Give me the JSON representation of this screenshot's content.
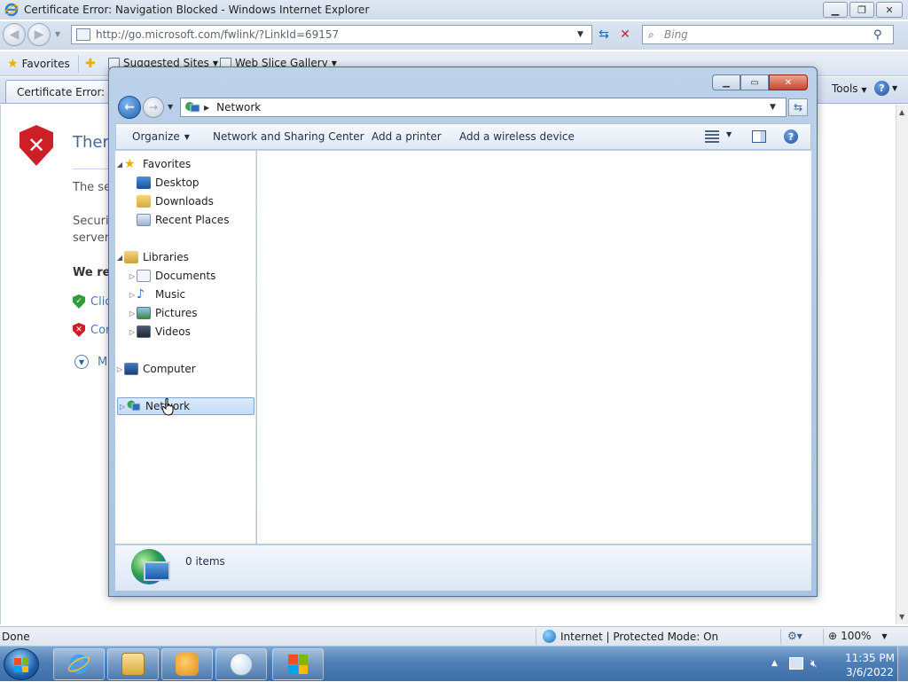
{
  "ie": {
    "title": "Certificate Error: Navigation Blocked - Windows Internet Explorer",
    "url": "http://go.microsoft.com/fwlink/?LinkId=69157",
    "search_placeholder": "Bing",
    "favorites_label": "Favorites",
    "suggested_sites": "Suggested Sites",
    "web_slice_gallery": "Web Slice Gallery",
    "tab_label": "Certificate Error: N",
    "tools_label": "Tools",
    "content": {
      "title": "There",
      "p1": "The se",
      "p2a": "Securit",
      "p2b": "server.",
      "bold": "We re",
      "opt1": "Clic",
      "opt2": "Cor",
      "more": "M"
    },
    "status": {
      "done": "Done",
      "zone": "Internet | Protected Mode: On",
      "zoom": "100%"
    }
  },
  "explorer": {
    "address": "Network",
    "commands": {
      "organize": "Organize",
      "network_sharing": "Network and Sharing Center",
      "add_printer": "Add a printer",
      "add_wireless": "Add a wireless device"
    },
    "nav": {
      "favorites": "Favorites",
      "desktop": "Desktop",
      "downloads": "Downloads",
      "recent_places": "Recent Places",
      "libraries": "Libraries",
      "documents": "Documents",
      "music": "Music",
      "pictures": "Pictures",
      "videos": "Videos",
      "computer": "Computer",
      "network": "Network"
    },
    "item_count": "0 items"
  },
  "taskbar": {
    "time": "11:35 PM",
    "date": "3/6/2022"
  },
  "colors": {
    "accent": "#1f5fb0",
    "error_red": "#cc1f27",
    "link_blue": "#4a7ab8"
  }
}
